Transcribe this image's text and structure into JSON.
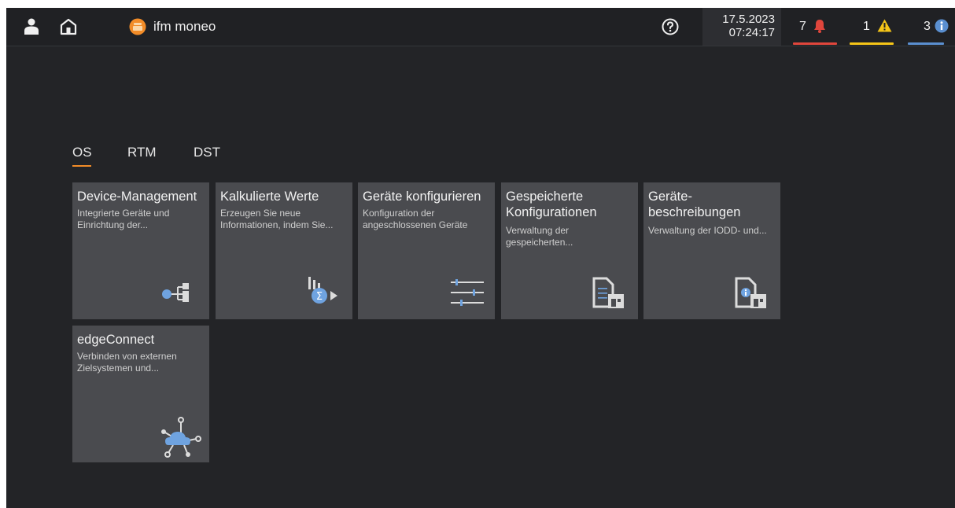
{
  "app": {
    "title": "ifm moneo"
  },
  "header": {
    "date": "17.5.2023",
    "time": "07:24:17",
    "alarm_count": "7",
    "warning_count": "1",
    "info_count": "3",
    "colors": {
      "alarm": "#e0463c",
      "warning": "#f5c518",
      "info": "#5a8fd0",
      "accent": "#f28c28"
    }
  },
  "tabs": [
    {
      "label": "OS",
      "active": true
    },
    {
      "label": "RTM",
      "active": false
    },
    {
      "label": "DST",
      "active": false
    }
  ],
  "tiles": [
    {
      "title": "Device-Management",
      "desc": "Integrierte Geräte und Einrichtung der...",
      "icon": "device-network-icon"
    },
    {
      "title": "Kalkulierte Werte",
      "desc": "Erzeugen Sie neue Informationen, indem Sie...",
      "icon": "calculation-icon"
    },
    {
      "title": "Geräte konfigurieren",
      "desc": "Konfiguration der angeschlossenen Geräte",
      "icon": "sliders-icon"
    },
    {
      "title": "Gespeicherte Konfigurationen",
      "desc": "Verwaltung der gespeicherten...",
      "icon": "saved-config-icon"
    },
    {
      "title": "Geräte-beschreibungen",
      "desc": "Verwaltung der IODD- und...",
      "icon": "device-description-icon"
    },
    {
      "title": "edgeConnect",
      "desc": "Verbinden von externen Zielsystemen und...",
      "icon": "cloud-connect-icon"
    }
  ]
}
